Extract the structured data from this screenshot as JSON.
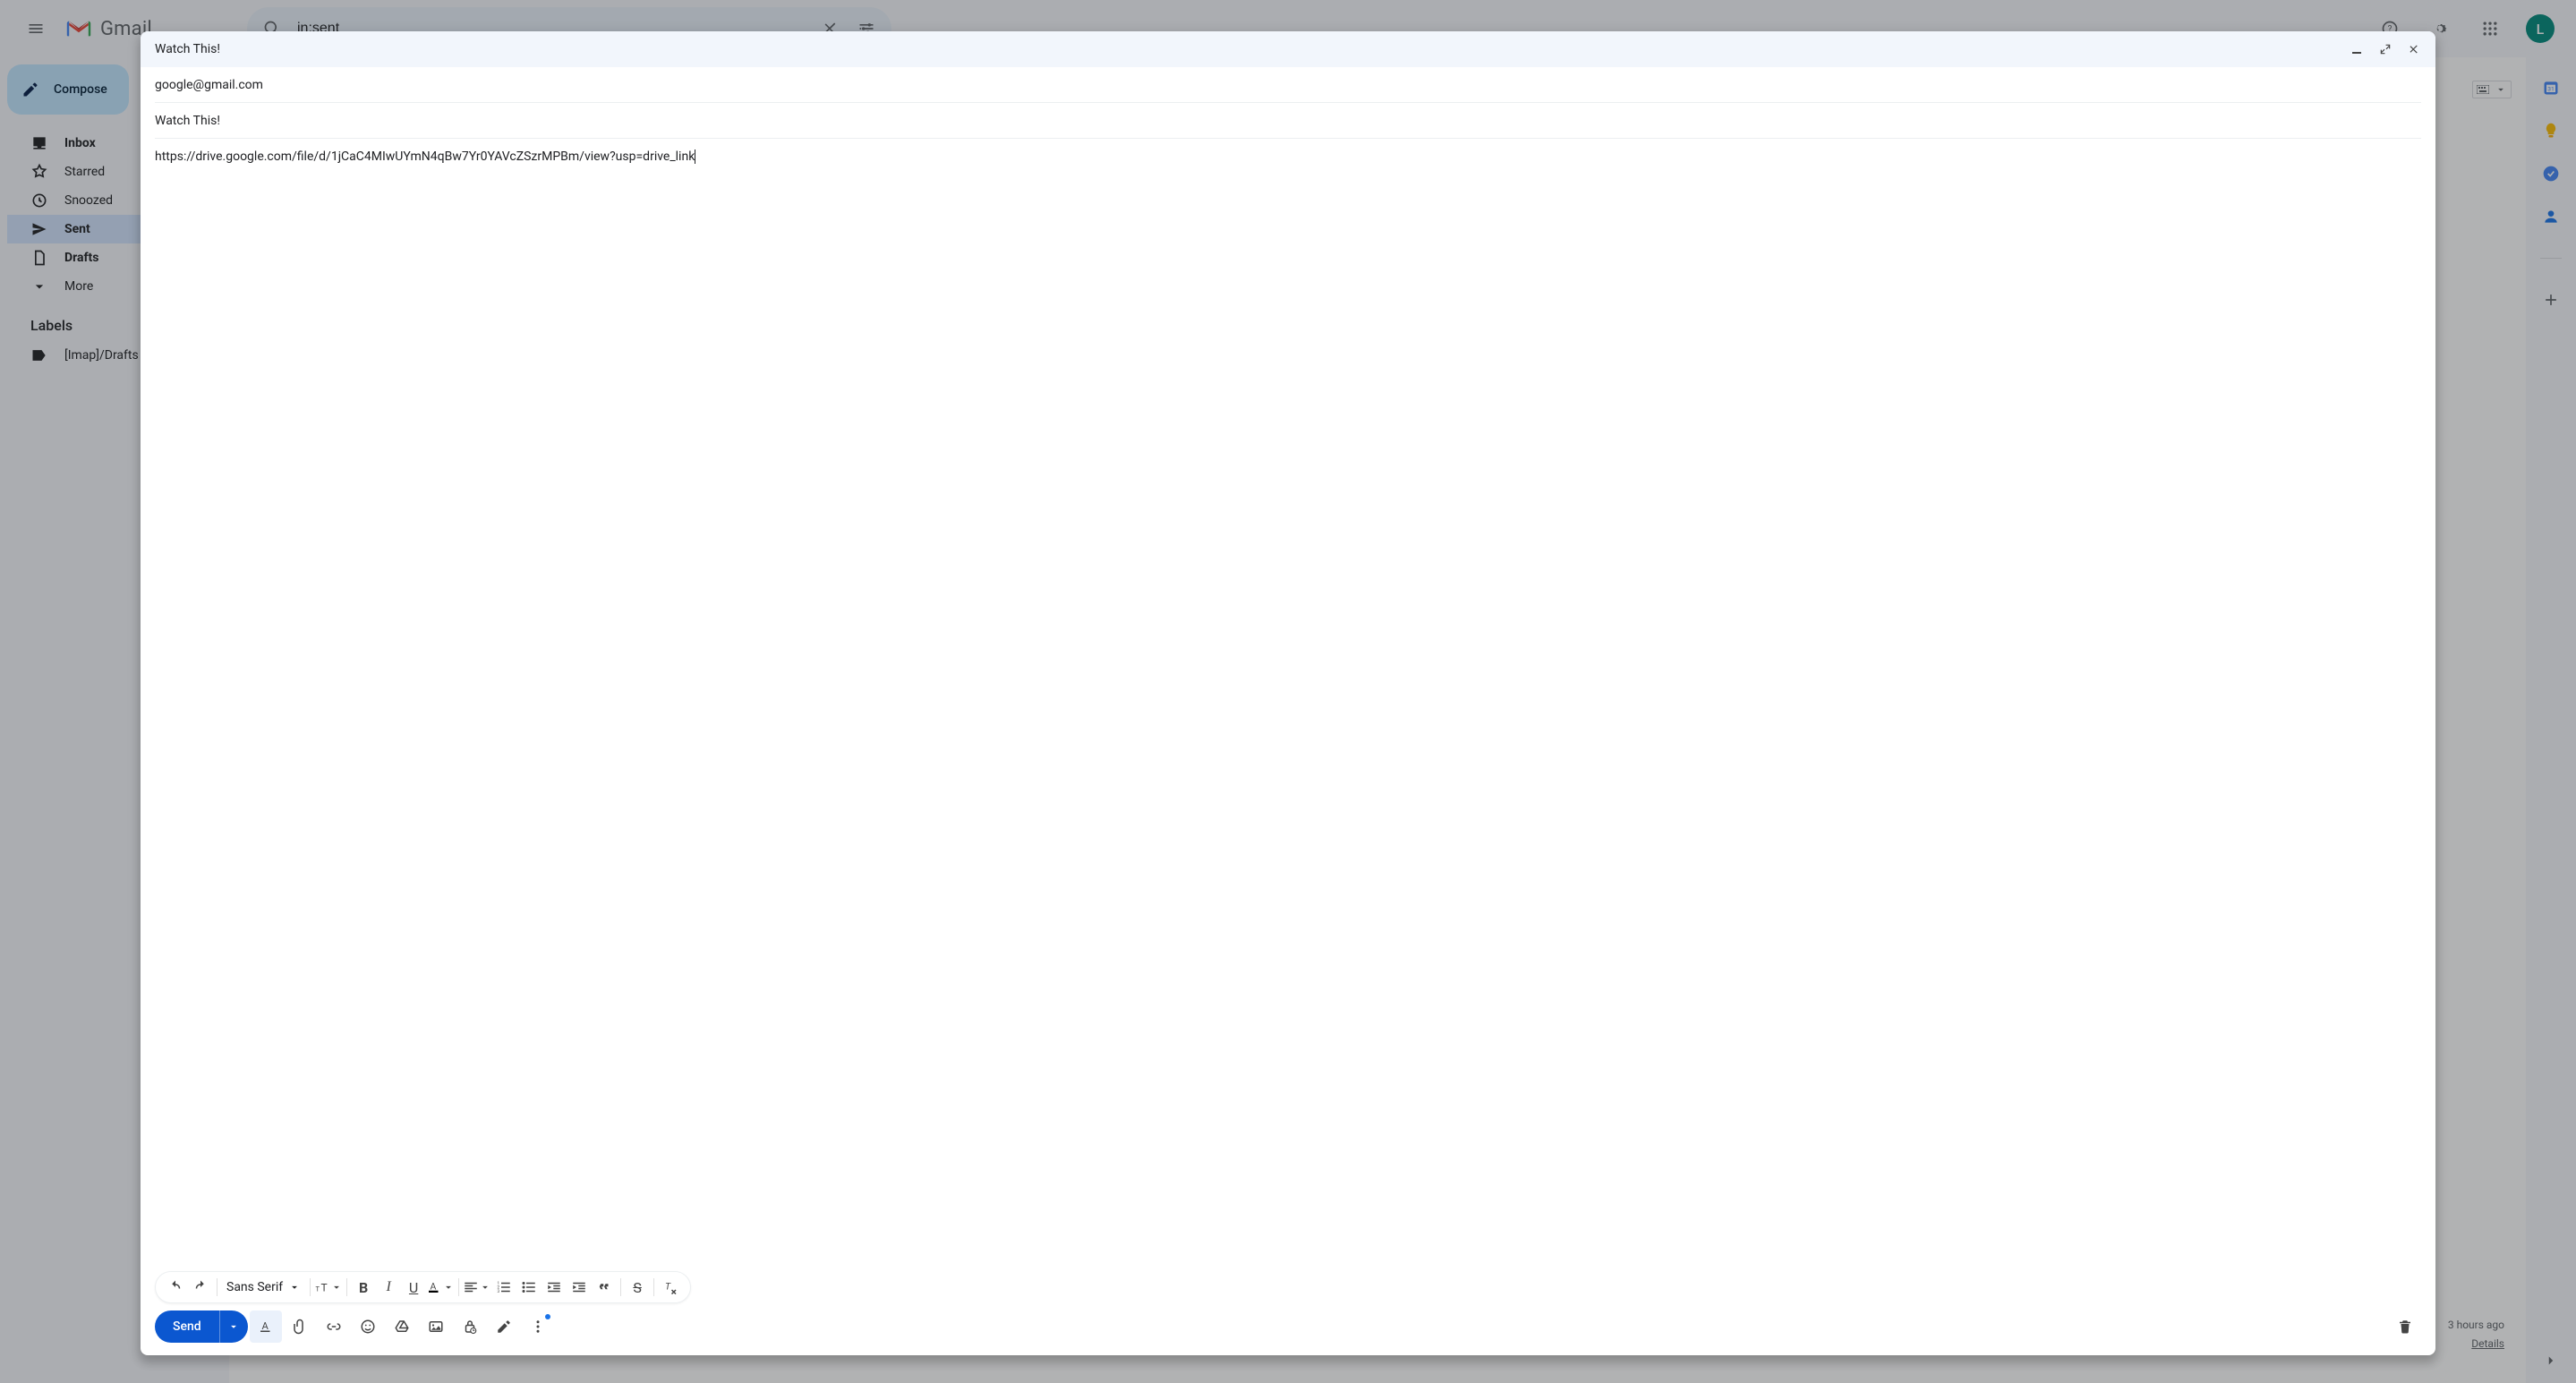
{
  "header": {
    "logo_text": "Gmail",
    "search_value": "in:sent",
    "avatar_letter": "L"
  },
  "sidebar": {
    "compose_label": "Compose",
    "items": [
      {
        "label": "Inbox",
        "icon": "inbox",
        "bold": true
      },
      {
        "label": "Starred",
        "icon": "star",
        "bold": false
      },
      {
        "label": "Snoozed",
        "icon": "clock",
        "bold": false
      },
      {
        "label": "Sent",
        "icon": "send",
        "bold": false,
        "active": true
      },
      {
        "label": "Drafts",
        "icon": "doc",
        "bold": true
      },
      {
        "label": "More",
        "icon": "chev",
        "bold": false
      }
    ],
    "labels_heading": "Labels",
    "labels": [
      {
        "label": "[Imap]/Drafts"
      }
    ]
  },
  "main": {
    "status_time": "3 hours ago",
    "status_details": "Details"
  },
  "compose": {
    "title": "Watch This!",
    "to": "google@gmail.com",
    "subject": "Watch This!",
    "body": "https://drive.google.com/file/d/1jCaC4MIwUYmN4qBw7Yr0YAVcZSzrMPBm/view?usp=drive_link",
    "font_name": "Sans Serif",
    "send_label": "Send"
  }
}
